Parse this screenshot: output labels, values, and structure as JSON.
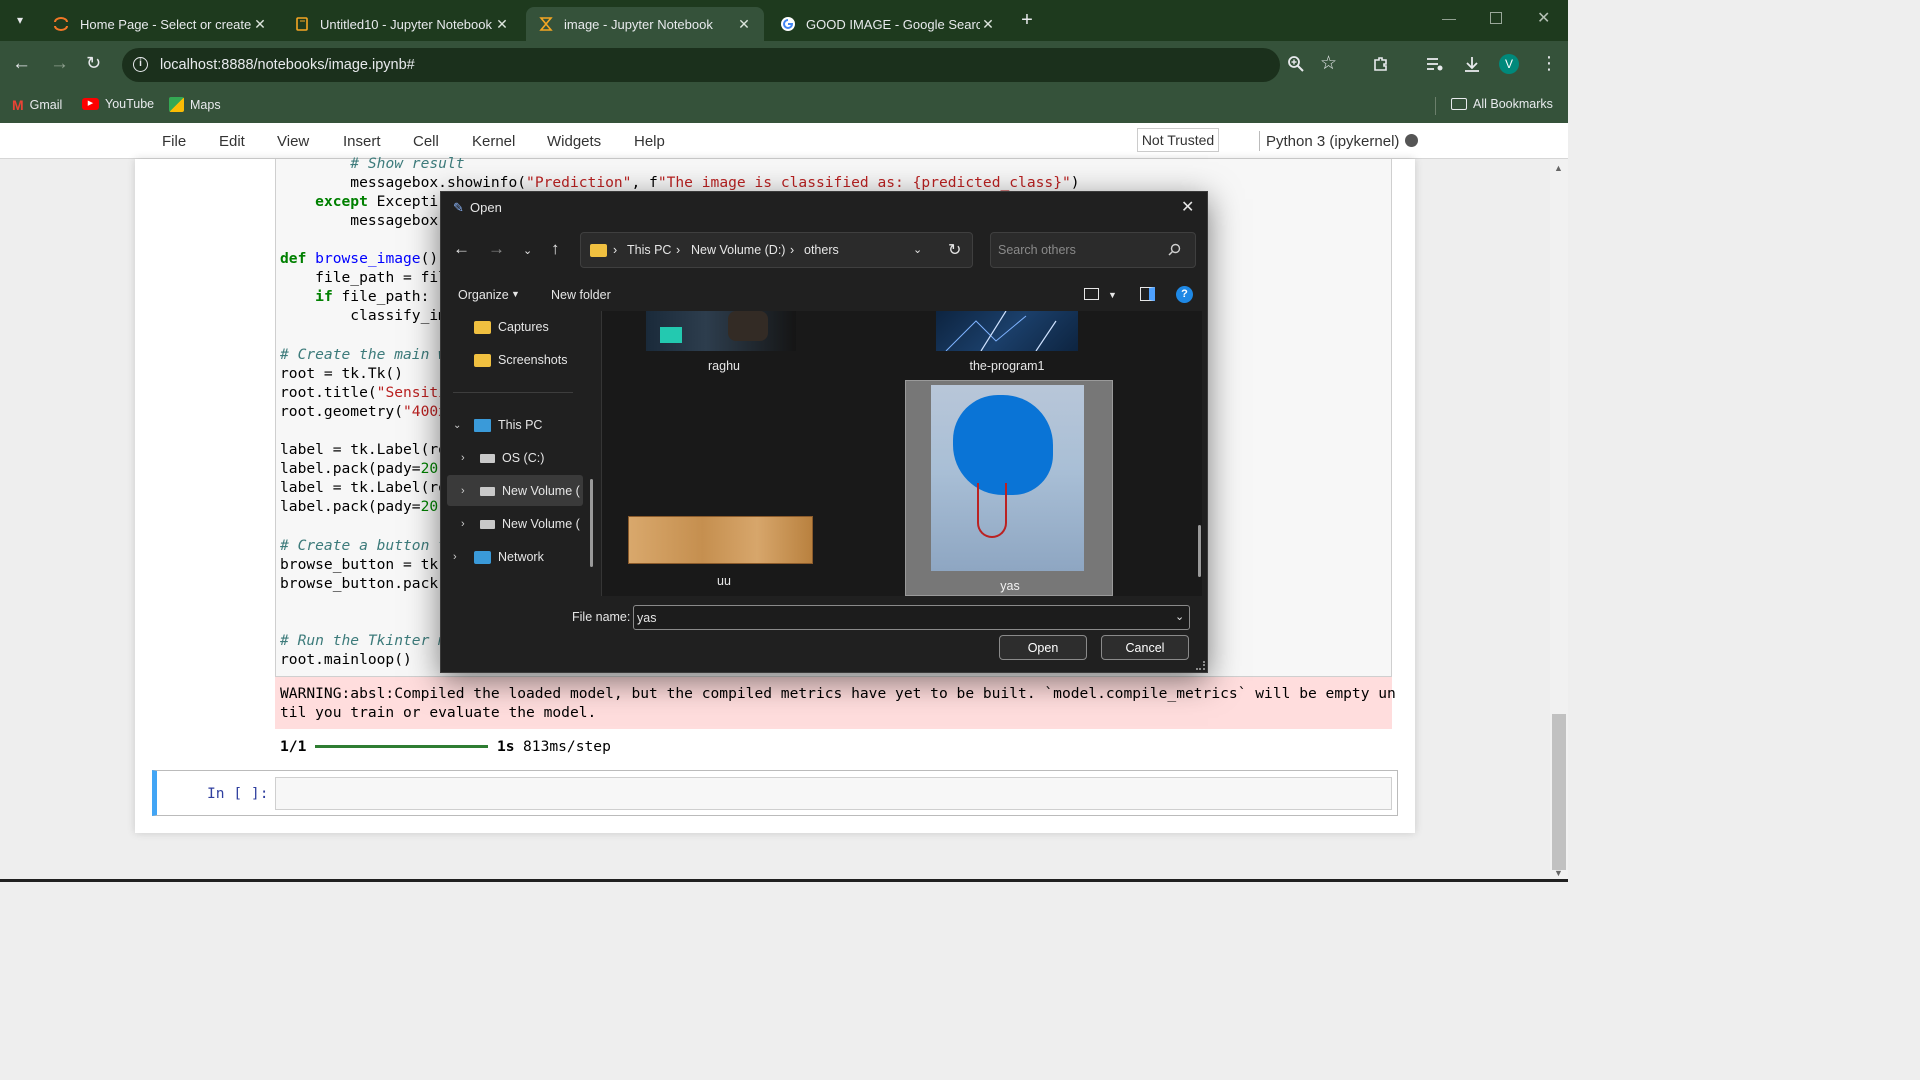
{
  "browser": {
    "tabs": [
      {
        "title": "Home Page - Select or create a"
      },
      {
        "title": "Untitled10 - Jupyter Notebook"
      },
      {
        "title": "image - Jupyter Notebook"
      },
      {
        "title": "GOOD IMAGE - Google Search"
      }
    ],
    "url": "localhost:8888/notebooks/image.ipynb#",
    "bookmarks": [
      "Gmail",
      "YouTube",
      "Maps"
    ],
    "all_bookmarks": "All Bookmarks",
    "profile_initial": "V"
  },
  "jupyter": {
    "menu": [
      "File",
      "Edit",
      "View",
      "Insert",
      "Cell",
      "Kernel",
      "Widgets",
      "Help"
    ],
    "trust": "Not Trusted",
    "kernel": "Python 3 (ipykernel)",
    "code": {
      "show_result": "# Show result",
      "msg_call": "messagebox.showinfo(",
      "msg_str1": "\"Prediction\"",
      "msg_mid": ", f",
      "msg_str2": "\"The image is classified as: {predicted_class}\"",
      "msg_end": ")",
      "except_kw": "except",
      "except_rest": " Excepti",
      "messagebox_cut": "messagebox.",
      "def_kw": "def",
      "def_name": "browse_image",
      "def_rest": "():",
      "file_path": "file_path = fil",
      "if_kw": "if",
      "if_rest": " file_path:",
      "classify": "classify_im",
      "cm_main": "# Create the main w",
      "root_tk": "root = tk.Tk()",
      "root_title": "root.title(",
      "root_title_str": "\"Sensiti",
      "root_geom": "root.geometry(",
      "root_geom_str": "\"400x",
      "label1": "label = tk.Label(ro",
      "pack1": "label.pack(pady=",
      "pack1_num": "20",
      "pack1_end": ")",
      "label2": "label = tk.Label(ro",
      "pack2": "label.pack(pady=",
      "pack2_num": "20",
      "pack2_end": ")",
      "cm_button": "# Create a button t",
      "browse_btn": "browse_button = tk.",
      "browse_pack": "browse_button.pack(",
      "cm_run": "# Run the Tkinter m",
      "mainloop": "root.mainloop()"
    },
    "warning_line1": "WARNING:absl:Compiled the loaded model, but the compiled metrics have yet to be built. `model.compile_metrics` will be empty un",
    "warning_line2": "til you train or evaluate the model.",
    "progress_step": "1/1",
    "progress_time": "1s",
    "progress_rate": "813ms/step",
    "progress_fraction": 1.0,
    "prompt": "In [ ]:"
  },
  "dialog": {
    "title": "Open",
    "breadcrumb": [
      "This PC",
      "New Volume (D:)",
      "others"
    ],
    "search_placeholder": "Search others",
    "organize": "Organize",
    "new_folder": "New folder",
    "nav": [
      {
        "label": "Captures",
        "icon": "folder-icon"
      },
      {
        "label": "Screenshots",
        "icon": "folder-icon"
      },
      {
        "label": "This PC",
        "icon": "computer-icon"
      },
      {
        "label": "OS (C:)",
        "icon": "drive-icon"
      },
      {
        "label": "New Volume (",
        "icon": "drive-icon"
      },
      {
        "label": "New Volume (",
        "icon": "drive-icon"
      },
      {
        "label": "Network",
        "icon": "network-icon"
      }
    ],
    "files": [
      "raghu",
      "the-program1",
      "uu",
      "yas"
    ],
    "file_name_label": "File name:",
    "file_name_value": "yas",
    "open_label": "Open",
    "cancel_label": "Cancel"
  },
  "colors": {
    "tab_strip": "#1e3a1e",
    "toolbar": "#35523a",
    "warning_bg": "#fdd",
    "cell_selected": "#42a5f5",
    "dialog_bg": "#202020",
    "selected_file": "#777777"
  }
}
